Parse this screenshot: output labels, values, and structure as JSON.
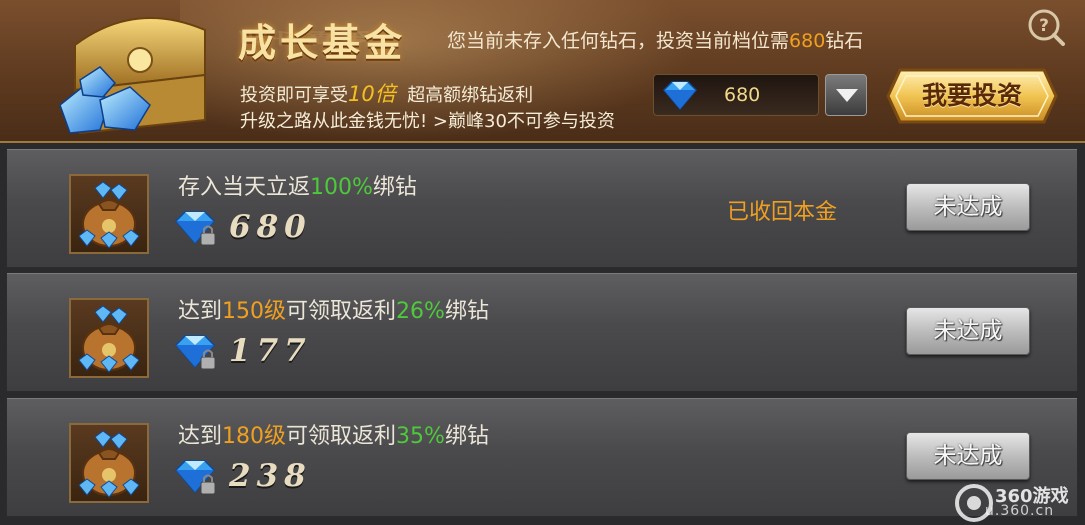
{
  "header": {
    "title": "成长基金",
    "title_reflection": "成长基金",
    "notice_prefix": "您当前未存入任何钻石，投资当前档位需",
    "notice_amount": "680",
    "notice_suffix": "钻石",
    "desc1_prefix": "投资即可享受",
    "desc1_multiplier": "10倍",
    "desc1_suffix": "超高额绑钻返利",
    "desc2": "升级之路从此金钱无忧! >巅峰30不可参与投资",
    "amount_value": "680",
    "invest_button": "我要投资"
  },
  "rows": [
    {
      "text_prefix": "存入当天立返",
      "text_level": "",
      "text_middle": "",
      "text_percent": "100%",
      "text_suffix": "绑钻",
      "value": "680",
      "status_note": "已收回本金",
      "button": "未达成"
    },
    {
      "text_prefix": "达到",
      "text_level": "150级",
      "text_middle": "可领取返利",
      "text_percent": "26%",
      "text_suffix": "绑钻",
      "value": "177",
      "status_note": "",
      "button": "未达成"
    },
    {
      "text_prefix": "达到",
      "text_level": "180级",
      "text_middle": "可领取返利",
      "text_percent": "35%",
      "text_suffix": "绑钻",
      "value": "238",
      "status_note": "",
      "button": "未达成"
    }
  ],
  "watermark": {
    "brand": "360游戏",
    "url": "u.360.cn"
  },
  "colors": {
    "highlight_orange": "#f0a020",
    "highlight_green": "#4ec93c",
    "header_bg": "#6a4326",
    "row_bg": "#4a4a4c"
  },
  "icons": [
    "treasure-chest-icon",
    "help-icon",
    "diamond-icon",
    "dropdown-arrow-icon",
    "bound-diamond-icon",
    "diamond-bag-icon"
  ]
}
